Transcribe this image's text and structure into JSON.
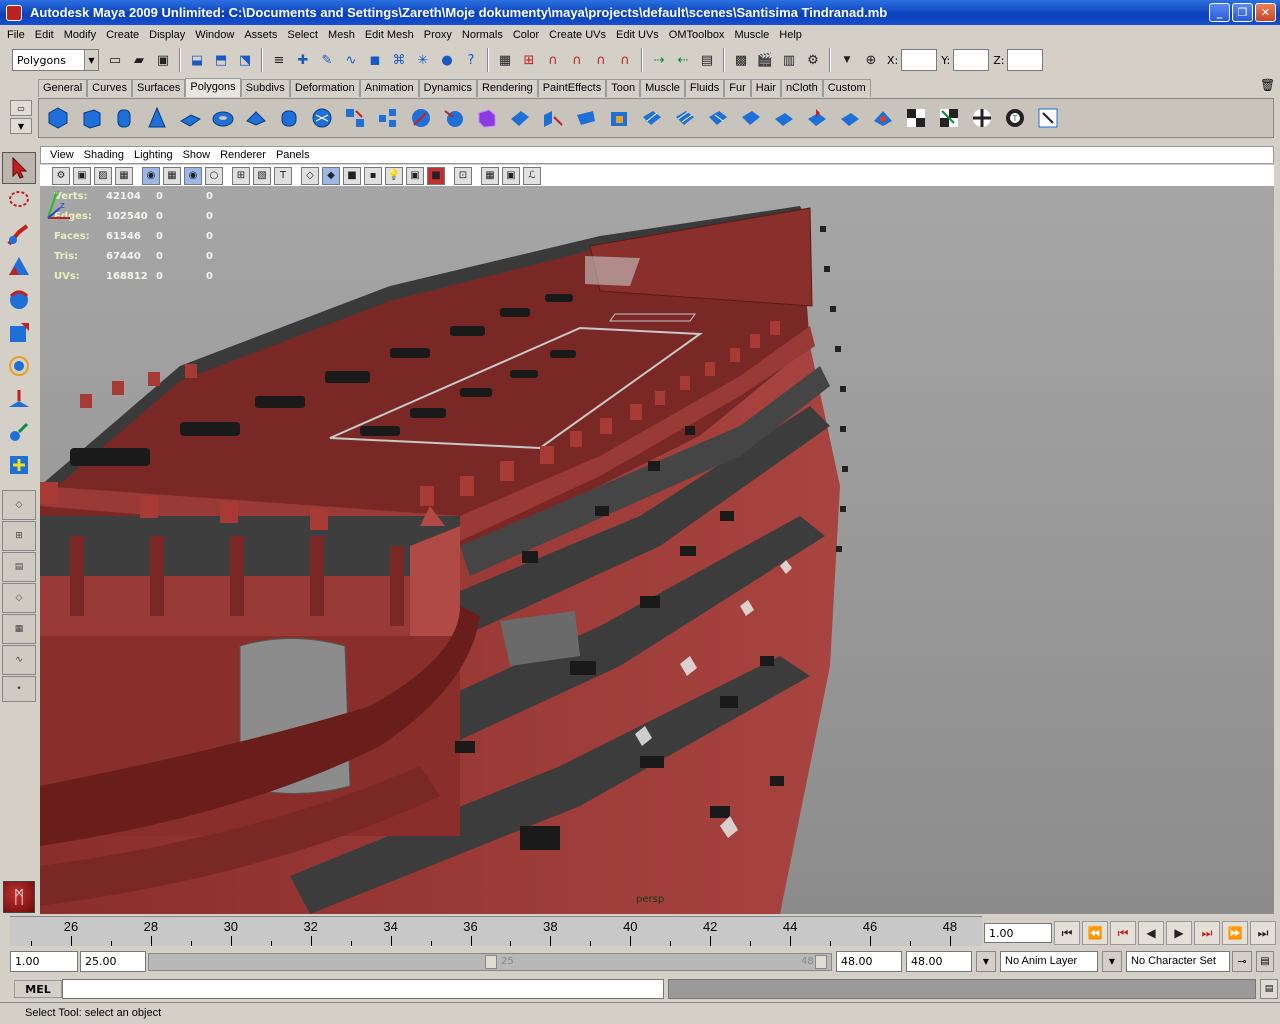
{
  "window": {
    "title": "Autodesk Maya 2009 Unlimited: C:\\Documents and Settings\\Zareth\\Moje dokumenty\\maya\\projects\\default\\scenes\\Santisima Tindranad.mb",
    "minimize": "_",
    "maximize": "❐",
    "close": "✕"
  },
  "menubar": [
    "File",
    "Edit",
    "Modify",
    "Create",
    "Display",
    "Window",
    "Assets",
    "Select",
    "Mesh",
    "Edit Mesh",
    "Proxy",
    "Normals",
    "Color",
    "Create UVs",
    "Edit UVs",
    "OMToolbox",
    "Muscle",
    "Help"
  ],
  "statusline": {
    "mode": "Polygons",
    "x_label": "X:",
    "y_label": "Y:",
    "z_label": "Z:"
  },
  "shelf": {
    "tabs": [
      "General",
      "Curves",
      "Surfaces",
      "Polygons",
      "Subdivs",
      "Deformation",
      "Animation",
      "Dynamics",
      "Rendering",
      "PaintEffects",
      "Toon",
      "Muscle",
      "Fluids",
      "Fur",
      "Hair",
      "nCloth",
      "Custom"
    ],
    "active_tab": "Polygons"
  },
  "panel": {
    "menu": [
      "View",
      "Shading",
      "Lighting",
      "Show",
      "Renderer",
      "Panels"
    ],
    "camera": "persp"
  },
  "hud": {
    "rows": [
      {
        "label": "Verts:",
        "v1": "42104",
        "v2": "0",
        "v3": "0"
      },
      {
        "label": "Edges:",
        "v1": "102540",
        "v2": "0",
        "v3": "0"
      },
      {
        "label": "Faces:",
        "v1": "61546",
        "v2": "0",
        "v3": "0"
      },
      {
        "label": "Tris:",
        "v1": "67440",
        "v2": "0",
        "v3": "0"
      },
      {
        "label": "UVs:",
        "v1": "168812",
        "v2": "0",
        "v3": "0"
      }
    ]
  },
  "timeslider": {
    "ticks": [
      "26",
      "28",
      "30",
      "32",
      "34",
      "36",
      "38",
      "40",
      "42",
      "44",
      "46",
      "48"
    ],
    "current_time": "1.00"
  },
  "range": {
    "start": "1.00",
    "playback_start": "25.00",
    "range_label_left": "25",
    "range_label_right": "48",
    "playback_end": "48.00",
    "end": "48.00",
    "anim_layer": "No Anim Layer",
    "character_set": "No Character Set"
  },
  "cmdline": {
    "label": "MEL"
  },
  "helpline": "Select Tool: select an object",
  "colors": {
    "viewport_bg": "#a0a0a0",
    "hull_red": "#9a3a38",
    "hull_dark": "#3c3c3c",
    "titlebar": "#0a3fb8"
  }
}
